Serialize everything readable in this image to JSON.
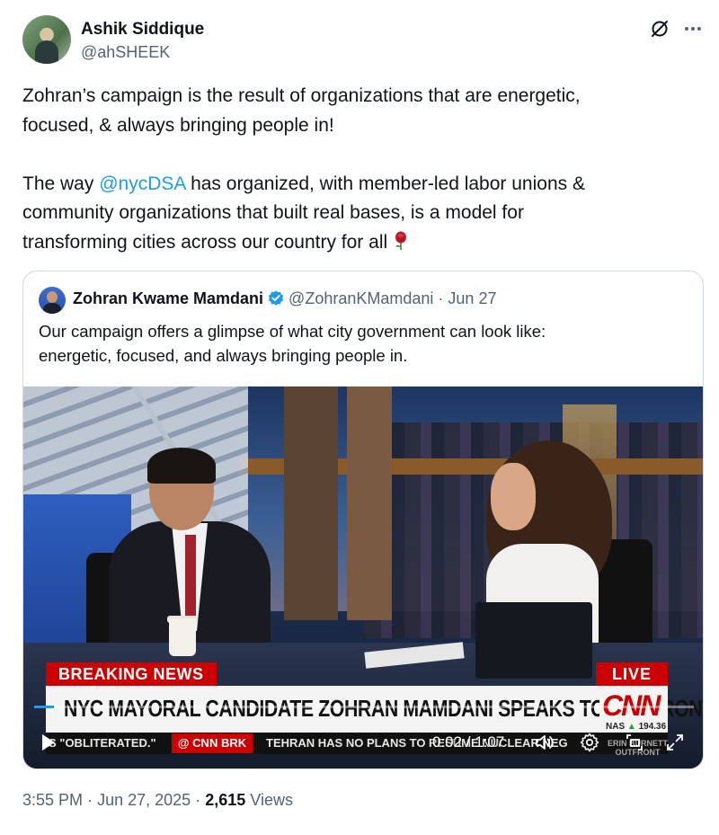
{
  "author": {
    "name": "Ashik Siddique",
    "handle": "@ahSHEEK"
  },
  "icons": {
    "grok": "grok-slash-icon",
    "more": "more-horizontal-icon",
    "rose": "rose-emoji-icon",
    "verified": "verified-badge-icon",
    "play": "play-icon",
    "volume": "volume-icon",
    "settings": "gear-icon",
    "pip": "picture-in-picture-icon",
    "fullscreen": "fullscreen-icon"
  },
  "tweet": {
    "line1": "Zohran’s campaign is the result of organizations that are energetic,",
    "line2": "focused, & always bringing people in!",
    "para2_prefix": "The way ",
    "mention": "@nycDSA",
    "para2_line1_suffix": " has organized, with member-led labor unions &",
    "para2_line2": "community organizations that built real bases, is a model for",
    "para2_line3": "transforming cities across our country for all"
  },
  "quote": {
    "name": "Zohran Kwame Mamdani",
    "handle": "@ZohranKMamdani",
    "separator": "·",
    "date": "Jun 27",
    "text_line1": "Our campaign offers a glimpse of what city government can look like:",
    "text_line2": "energetic, focused, and always bringing people in."
  },
  "video": {
    "breaking": "BREAKING NEWS",
    "live": "LIVE",
    "headline": "NYC MAYORAL CANDIDATE ZOHRAN MAMDANI SPEAKS TO OUTFRONT",
    "network": "CNN",
    "nas_label": "NAS",
    "nas_arrow": "▲",
    "nas_value": "194.36",
    "ticker1": "S \"OBLITERATED.\"",
    "ticker_brand": "@ CNN BRK",
    "ticker2": "TEHRAN HAS NO PLANS TO RESUME NUCLEAR NEG",
    "show_line1": "ERIN BURNETT",
    "show_line2": "OUTFRONT",
    "time": "0:02 / 1:07",
    "progress": 0.03
  },
  "meta": {
    "time": "3:55 PM",
    "sep": "·",
    "date": "Jun 27, 2025",
    "views_count": "2,615",
    "views_label": "Views"
  },
  "colors": {
    "accent": "#1d9bf0",
    "cnn_red": "#cc0000"
  }
}
